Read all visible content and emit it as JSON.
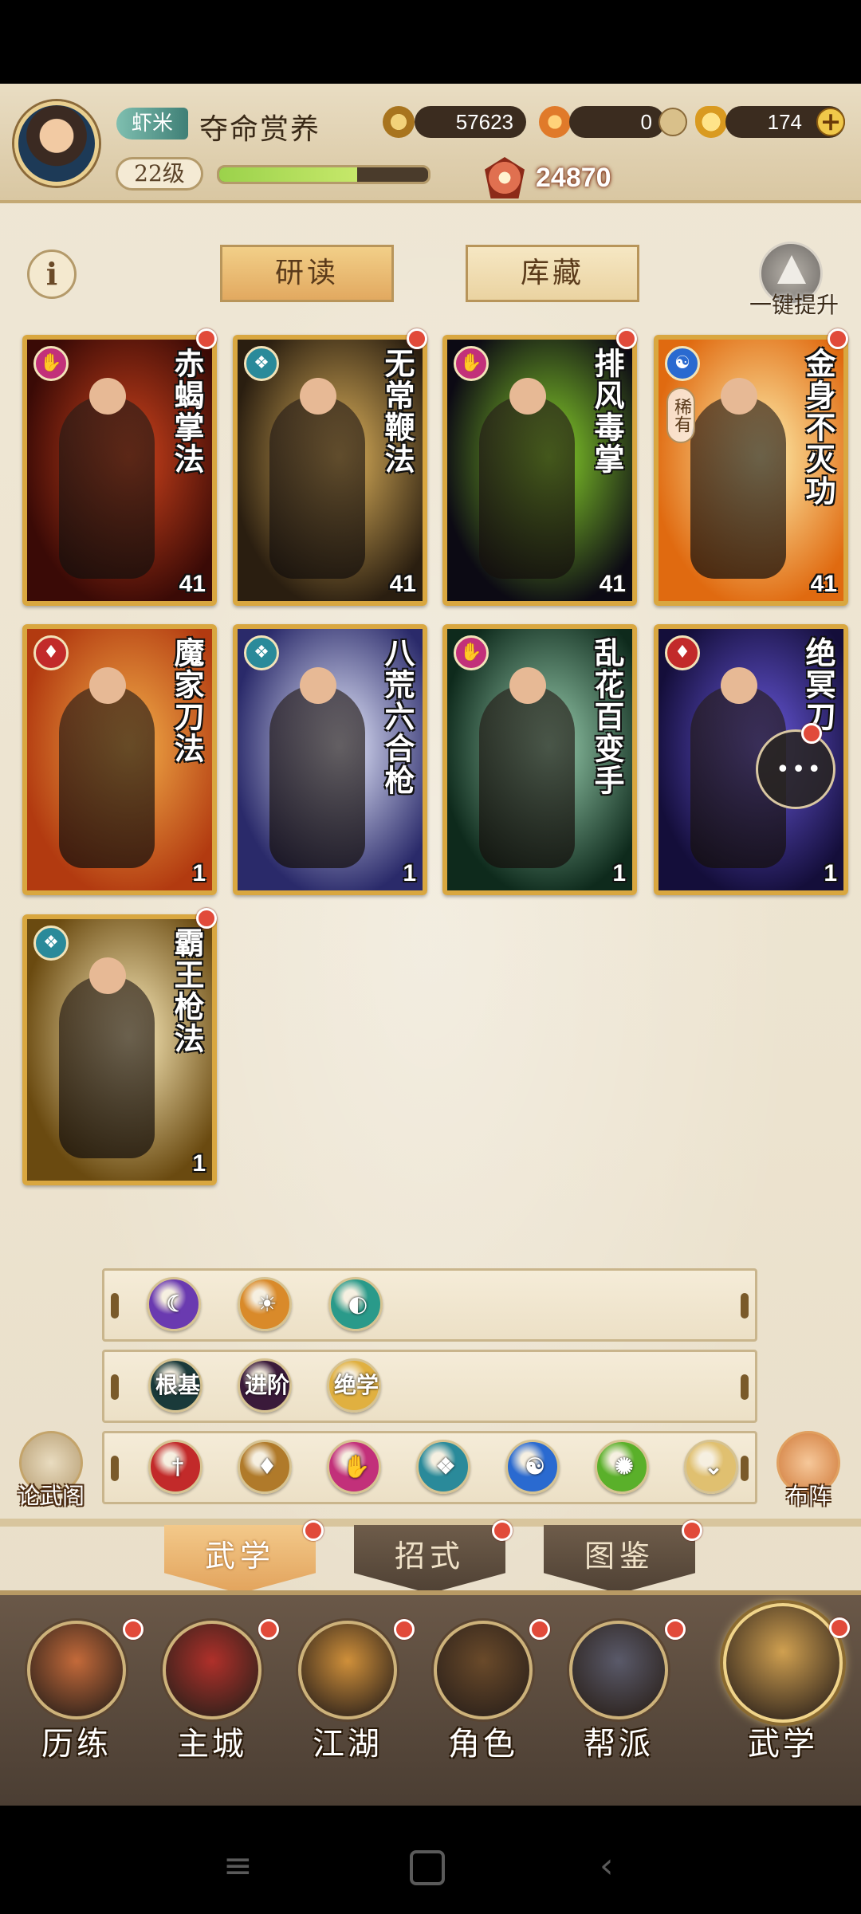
{
  "player": {
    "title_tag": "虾米",
    "name": "夺命赏养",
    "level": "22级",
    "exp_progress": 0.66,
    "power": "24870"
  },
  "resources": [
    {
      "icon": "copper-coin-icon",
      "value": "57623",
      "color": "#d9a740"
    },
    {
      "icon": "flame-token-icon",
      "value": "0",
      "color": "#e07a2a"
    },
    {
      "icon": "gold-ingot-icon",
      "value": "174",
      "color": "#f2c24a"
    }
  ],
  "tabs": {
    "study": "研读",
    "collection": "库藏",
    "upgrade_all": "一键提升"
  },
  "cards": [
    {
      "name": "赤蝎掌法",
      "count": "41",
      "school": "palm",
      "school_color": "#c2307a",
      "bg1": "#3a0a06",
      "bg2": "#d1441c",
      "badge": true,
      "rare": ""
    },
    {
      "name": "无常鞭法",
      "count": "41",
      "school": "fan",
      "school_color": "#2a8a9a",
      "bg1": "#2a1e10",
      "bg2": "#e0b45c",
      "badge": true,
      "rare": ""
    },
    {
      "name": "排风毒掌",
      "count": "41",
      "school": "palm",
      "school_color": "#c2307a",
      "bg1": "#0c0a14",
      "bg2": "#8ad62a",
      "badge": true,
      "rare": ""
    },
    {
      "name": "金身不灭功",
      "count": "41",
      "school": "taiji",
      "school_color": "#2a6ad0",
      "bg1": "#e06a10",
      "bg2": "#fff2b0",
      "badge": true,
      "rare": "稀有"
    },
    {
      "name": "魔家刀法",
      "count": "1",
      "school": "blade",
      "school_color": "#c22a2a",
      "bg1": "#b23a10",
      "bg2": "#f4b04a",
      "badge": false,
      "rare": ""
    },
    {
      "name": "八荒六合枪",
      "count": "1",
      "school": "fan",
      "school_color": "#2a8a9a",
      "bg1": "#2a2a6a",
      "bg2": "#e8ecff",
      "badge": false,
      "rare": ""
    },
    {
      "name": "乱花百变手",
      "count": "1",
      "school": "palm",
      "school_color": "#c2307a",
      "bg1": "#0e2a1c",
      "bg2": "#9ad0b0",
      "badge": false,
      "rare": ""
    },
    {
      "name": "绝冥刀",
      "count": "1",
      "school": "blade",
      "school_color": "#c22a2a",
      "bg1": "#140e3a",
      "bg2": "#6a5ae0",
      "badge": false,
      "rare": ""
    },
    {
      "name": "霸王枪法",
      "count": "1",
      "school": "fan",
      "school_color": "#2a8a9a",
      "bg1": "#6a4a10",
      "bg2": "#fff0c0",
      "badge": true,
      "rare": ""
    }
  ],
  "filters": {
    "row1": [
      {
        "icon": "yin-moon-icon",
        "color": "#6a3ab0"
      },
      {
        "icon": "yang-sun-icon",
        "color": "#d98a2a"
      },
      {
        "icon": "neutral-circle-icon",
        "color": "#2a9a8a"
      }
    ],
    "row2": [
      {
        "icon": "root-token-icon",
        "label": "根基",
        "color": "#1a3a3a"
      },
      {
        "icon": "advanced-token-icon",
        "label": "进阶",
        "color": "#3a1a3a"
      },
      {
        "icon": "ultimate-token-icon",
        "label": "绝学",
        "color": "#e0b040"
      }
    ],
    "row3": [
      {
        "icon": "sword-school-icon",
        "color": "#c22a2a"
      },
      {
        "icon": "blade-school-icon",
        "color": "#b07a2a"
      },
      {
        "icon": "palm-school-icon",
        "color": "#c2307a"
      },
      {
        "icon": "fan-school-icon",
        "color": "#2a8a9a"
      },
      {
        "icon": "taiji-school-icon",
        "color": "#2a6ad0"
      },
      {
        "icon": "hidden-weapon-school-icon",
        "color": "#5ab02a"
      },
      {
        "icon": "chevron-down-icon",
        "color": "#e0c070"
      }
    ]
  },
  "side": {
    "left_label": "论武阁",
    "right_label": "布阵"
  },
  "sections": [
    "武学",
    "招式",
    "图鉴"
  ],
  "nav": [
    {
      "label": "历练",
      "icon": "training-icon",
      "color": "#c46a3a"
    },
    {
      "label": "主城",
      "icon": "city-icon",
      "color": "#b0302a"
    },
    {
      "label": "江湖",
      "icon": "world-icon",
      "color": "#d0903a"
    },
    {
      "label": "角色",
      "icon": "character-icon",
      "color": "#6a4a2a"
    },
    {
      "label": "帮派",
      "icon": "guild-icon",
      "color": "#5a5a6a"
    },
    {
      "label": "武学",
      "icon": "martial-arts-icon",
      "color": "#d0a050"
    }
  ]
}
